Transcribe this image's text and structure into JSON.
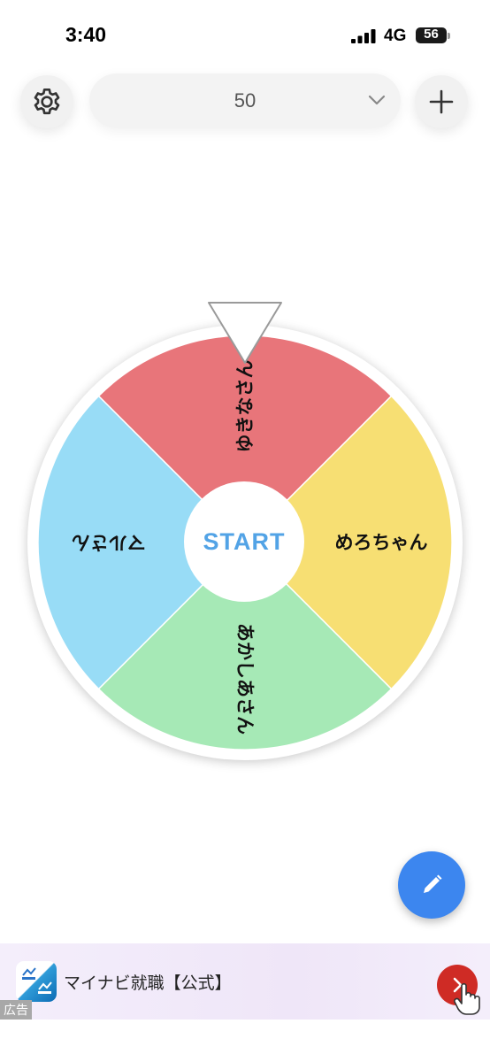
{
  "status_bar": {
    "time": "3:40",
    "network": "4G",
    "battery": "56"
  },
  "header": {
    "settings_icon": "gear-icon",
    "select_value": "50",
    "select_icon": "chevron-down-icon",
    "add_icon": "plus-icon"
  },
  "wheel": {
    "start_label": "START",
    "segments": [
      {
        "label": "ゆきなさん",
        "color": "#e8757a"
      },
      {
        "label": "めろちゃん",
        "color": "#f7df73"
      },
      {
        "label": "あかしあさん",
        "color": "#a6e9b6"
      },
      {
        "label": "マルさん",
        "color": "#98dcf6"
      }
    ]
  },
  "fab": {
    "icon": "pencil-icon",
    "color": "#3c86ef"
  },
  "ad": {
    "title": "マイナビ就職【公式】",
    "label": "広告",
    "cta_icon": "chevron-right-icon"
  }
}
